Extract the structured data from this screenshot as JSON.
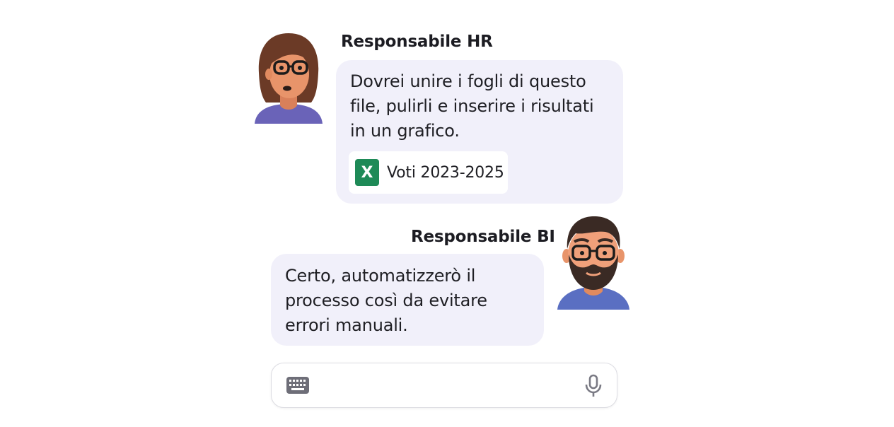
{
  "messages": [
    {
      "sender": "Responsabile HR",
      "text_lines": [
        "Dovrei unire i fogli di questo",
        "file, pulirli e inserire i risultati",
        "in un grafico."
      ],
      "attachment": {
        "icon": "excel-file-icon",
        "icon_label": "X",
        "name": "Voti 2023-2025"
      }
    },
    {
      "sender": "Responsabile BI",
      "text_lines": [
        "Certo, automatizzerò il",
        "processo così da evitare",
        "errori manuali."
      ]
    }
  ],
  "composer": {
    "left_icon": "keyboard-icon",
    "right_icon": "microphone-icon",
    "value": ""
  },
  "colors": {
    "bubble": "#f1f0fa",
    "excel": "#1e8a57",
    "avatar_shirt": "#6a63b8",
    "skin": "#e8946a"
  }
}
